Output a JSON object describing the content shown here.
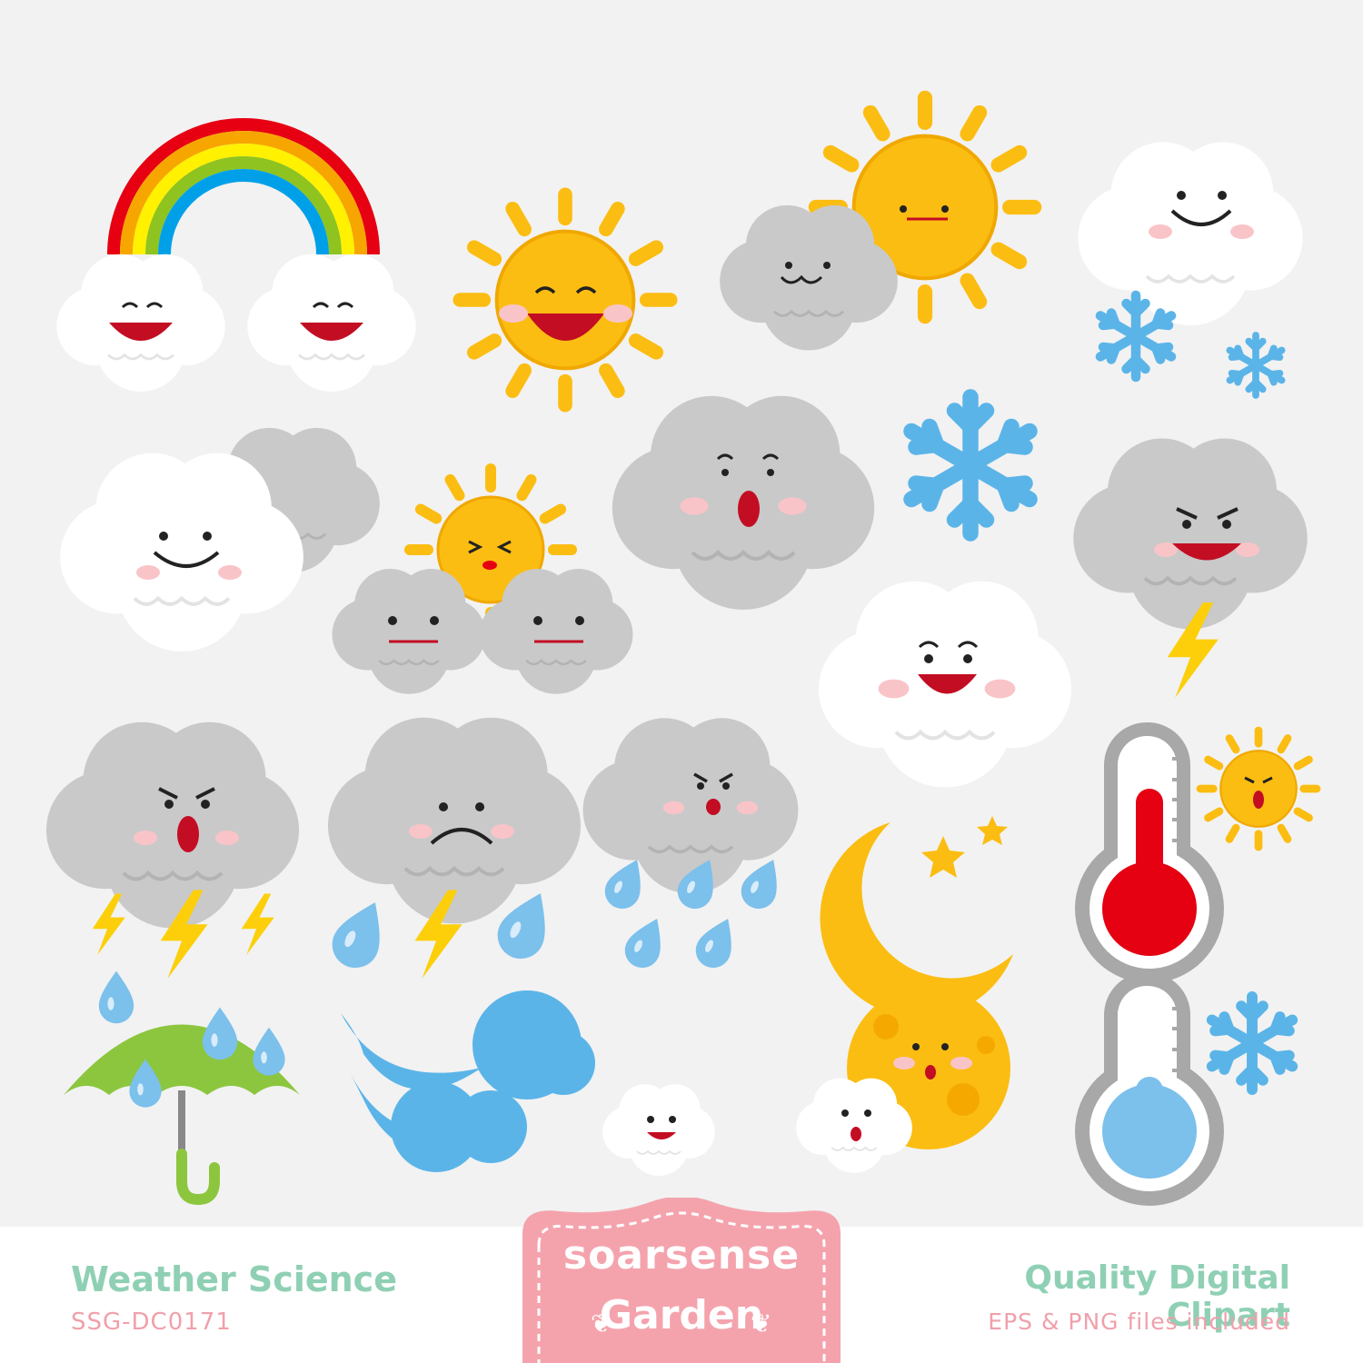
{
  "colors": {
    "background": "#f2f2f2",
    "sun": "#fbbd12",
    "cloud_white": "#ffffff",
    "cloud_gray": "#c9c9c9",
    "snow_blue": "#5bb4e8",
    "rain_blue": "#7cc0ec",
    "lightning": "#fccf0a",
    "thermo_red": "#e50012",
    "umbrella_green": "#8cc63f",
    "badge_pink": "#f4a3ad",
    "title_mint": "#8fd0b4",
    "subtitle_pink": "#f0a0ab"
  },
  "icons": [
    "rainbow-clouds-icon",
    "laughing-sun-icon",
    "sun-behind-cloud-icon",
    "snow-cloud-icon",
    "partly-cloudy-icon",
    "sun-between-clouds-icon",
    "surprised-gray-cloud-icon",
    "snowflake-icon",
    "angry-thunder-cloud-icon",
    "happy-white-cloud-icon",
    "thunderstorm-icon",
    "sad-storm-cloud-icon",
    "rain-cloud-icon",
    "crescent-moon-stars-icon",
    "hot-thermometer-icon",
    "umbrella-icon",
    "wind-icon",
    "moon-cloud-icon",
    "full-moon-cloud-icon",
    "cold-thermometer-icon"
  ],
  "footer": {
    "product_title": "Weather Science",
    "product_code": "SSG-DC0171",
    "brand_line1": "soarsense",
    "brand_line2": "Garden",
    "tagline": "Quality Digital Clipart",
    "files_note": "EPS & PNG files included"
  }
}
